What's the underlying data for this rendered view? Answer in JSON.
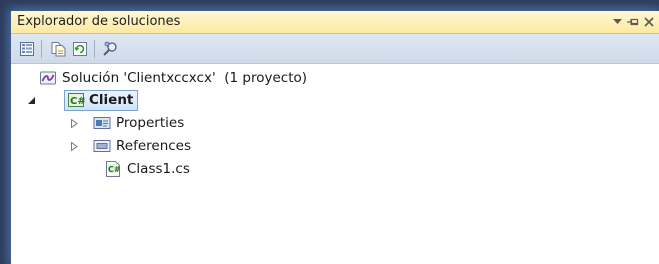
{
  "panel": {
    "title": "Explorador de soluciones",
    "controls": [
      "dropdown-icon",
      "pin-icon",
      "close-icon"
    ]
  },
  "toolbar": {
    "buttons": [
      "properties-icon",
      "show-all-files-icon",
      "refresh-icon",
      "class-view-icon"
    ]
  },
  "tree": {
    "solution_label": "Solución 'Clientxccxcx'  (1 proyecto)",
    "project_label": "Client",
    "items": [
      {
        "label": "Properties",
        "icon": "properties-folder-icon",
        "expandable": true
      },
      {
        "label": "References",
        "icon": "references-folder-icon",
        "expandable": true
      },
      {
        "label": "Class1.cs",
        "icon": "csharp-file-icon",
        "expandable": false
      }
    ]
  },
  "colors": {
    "title_bar": "#fde9a0",
    "toolbar": "#d6dfec",
    "selection_border": "#7da2ce",
    "frame": "#2b3b5a"
  }
}
